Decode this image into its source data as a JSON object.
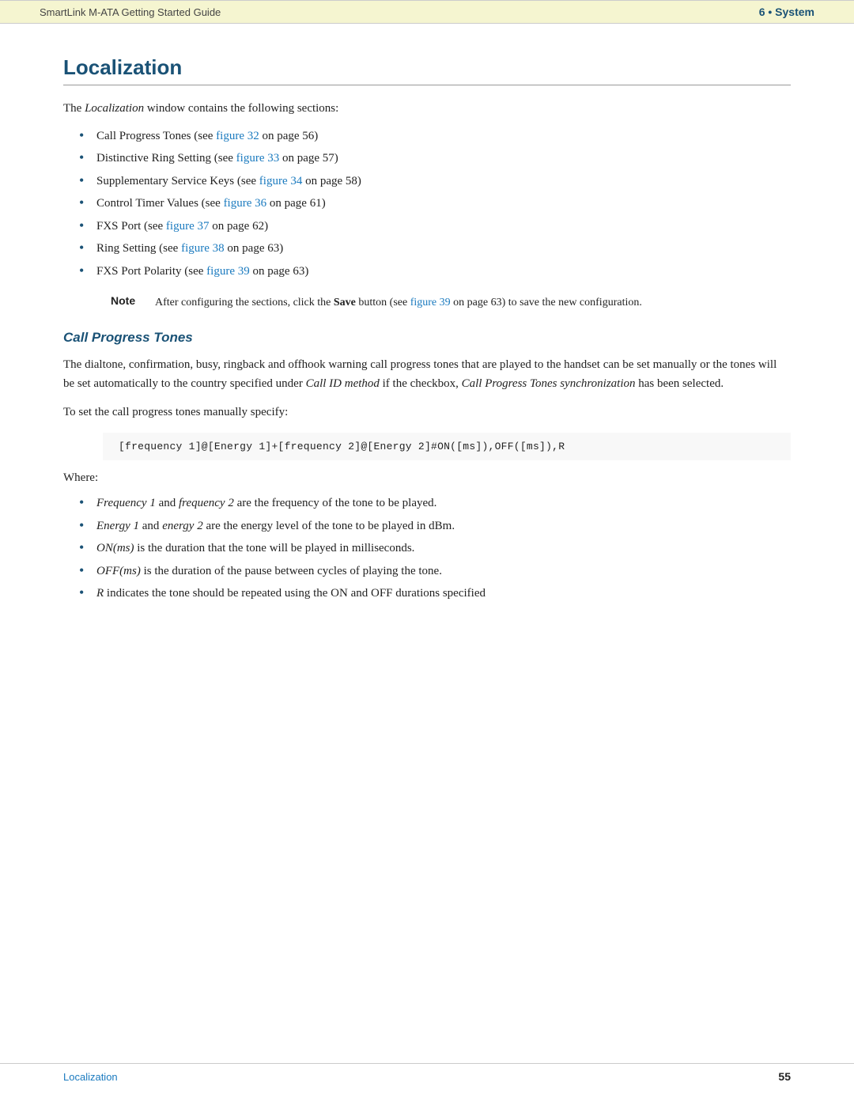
{
  "header": {
    "left": "SmartLink M-ATA Getting Started Guide",
    "right": "6 • System"
  },
  "section": {
    "title": "Localization",
    "intro": "The Localization window contains the following sections:",
    "bullet_items": [
      {
        "text": "Call Progress Tones (see ",
        "link": "figure 32",
        "after": " on page 56)"
      },
      {
        "text": "Distinctive Ring Setting (see ",
        "link": "figure 33",
        "after": " on page 57)"
      },
      {
        "text": "Supplementary Service Keys (see ",
        "link": "figure 34",
        "after": " on page 58)"
      },
      {
        "text": "Control Timer Values (see ",
        "link": "figure 36",
        "after": " on page 61)"
      },
      {
        "text": "FXS Port (see ",
        "link": "figure 37",
        "after": " on page 62)"
      },
      {
        "text": "Ring Setting (see ",
        "link": "figure 38",
        "after": " on page 63)"
      },
      {
        "text": "FXS Port Polarity (see ",
        "link": "figure 39",
        "after": " on page 63)"
      }
    ],
    "note_label": "Note",
    "note_text": "After configuring the sections, click the ",
    "note_bold": "Save",
    "note_after": " button (see ",
    "note_link": "figure 39",
    "note_end": " on page 63) to save the new configuration.",
    "subsection_title": "Call Progress Tones",
    "body1": "The dialtone, confirmation, busy, ringback and offhook warning call progress tones that are played to the handset can be set manually or the tones will be set automatically to the country specified under Call ID method if the checkbox, Call Progress Tones synchronization has been selected.",
    "body1_italic1": "Call ID method",
    "body1_italic2": "Call Progress Tones synchronization",
    "body2": "To set the call progress tones manually specify:",
    "code": "[frequency 1]@[Energy 1]+[frequency 2]@[Energy 2]#ON([ms]),OFF([ms]),R",
    "where_label": "Where:",
    "where_items": [
      {
        "italic": "Frequency 1",
        "connector": " and ",
        "italic2": "frequency 2",
        "rest": " are the frequency of the tone to be played."
      },
      {
        "italic": "Energy 1",
        "connector": " and ",
        "italic2": "energy 2",
        "rest": " are the energy level of the tone to be played in dBm."
      },
      {
        "italic": "ON(ms)",
        "connector": "",
        "italic2": "",
        "rest": " is the duration that the tone will be played in milliseconds."
      },
      {
        "italic": "OFF(ms)",
        "connector": "",
        "italic2": "",
        "rest": " is the duration of the pause between cycles of playing the tone."
      },
      {
        "italic": "R",
        "connector": "",
        "italic2": "",
        "rest": " indicates the tone should be repeated using the ON and OFF durations specified"
      }
    ]
  },
  "footer": {
    "left": "Localization",
    "right": "55"
  }
}
